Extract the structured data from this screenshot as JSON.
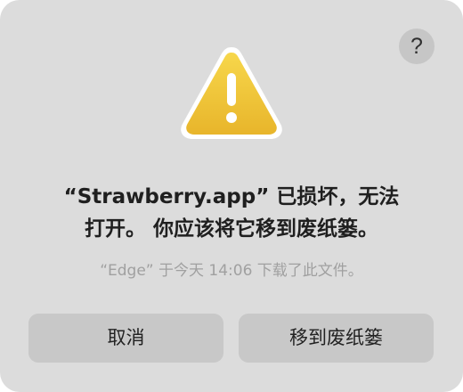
{
  "dialog": {
    "help_label": "?",
    "title_line_1": "“Strawberry.app” 已损坏，无法",
    "title_line_2": "打开。 你应该将它移到废纸篓。",
    "subtitle": "“Edge” 于今天 14:06 下载了此文件。",
    "cancel_label": "取消",
    "move_to_trash_label": "移到废纸篓",
    "icon": "warning-icon"
  },
  "colors": {
    "dialog_background": "#dcdcdc",
    "button_background": "#c8c8c8",
    "warning_yellow": "#f3c734",
    "warning_outline": "#ffffff",
    "warning_mark": "#ffffff",
    "subtitle_gray": "#a0a0a0"
  }
}
